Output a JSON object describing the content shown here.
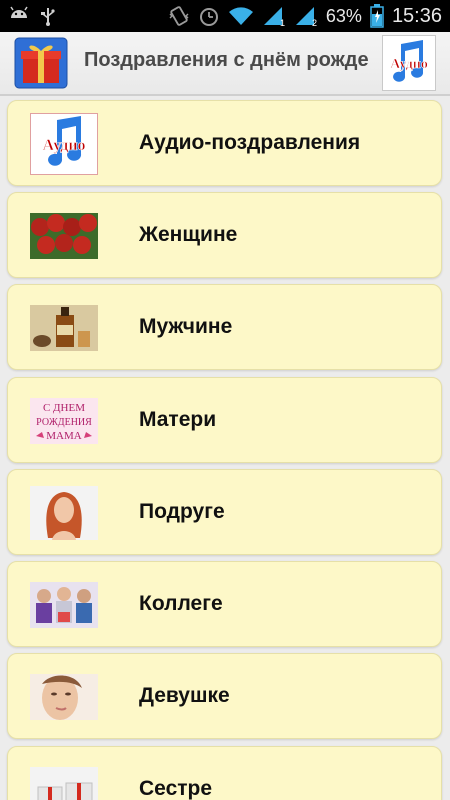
{
  "status_bar": {
    "battery": "63%",
    "time": "15:36",
    "sim1": "1",
    "sim2": "2",
    "icons": [
      "android-icon",
      "usb-icon",
      "vibrate-icon",
      "alarm-icon",
      "wifi-icon",
      "signal-1-icon",
      "signal-2-icon",
      "battery-icon"
    ]
  },
  "app_bar": {
    "title": "Поздравления с днём рожде",
    "icon": "gift-icon",
    "audio_icon": "music-note-icon",
    "audio_label": "Аудио"
  },
  "list": {
    "items": [
      {
        "label": "Аудио-поздравления",
        "thumb": "audio-thumb",
        "thumb_text": "Аудио"
      },
      {
        "label": "Женщине",
        "thumb": "roses-thumb"
      },
      {
        "label": "Мужчине",
        "thumb": "whiskey-thumb"
      },
      {
        "label": "Матери",
        "thumb": "greeting-text-thumb",
        "thumb_text": [
          "С ДНЕМ",
          "РОЖДЕНИЯ",
          "МАМА"
        ]
      },
      {
        "label": "Подруге",
        "thumb": "woman-portrait-thumb"
      },
      {
        "label": "Коллеге",
        "thumb": "colleagues-thumb"
      },
      {
        "label": "Девушке",
        "thumb": "girl-face-thumb"
      },
      {
        "label": "Сестре",
        "thumb": "gift-box-thumb"
      }
    ]
  },
  "colors": {
    "item_bg": "#fdf8c8",
    "status_bg": "#000000",
    "audio_red": "#c00000",
    "music_blue": "#2a7be0"
  }
}
